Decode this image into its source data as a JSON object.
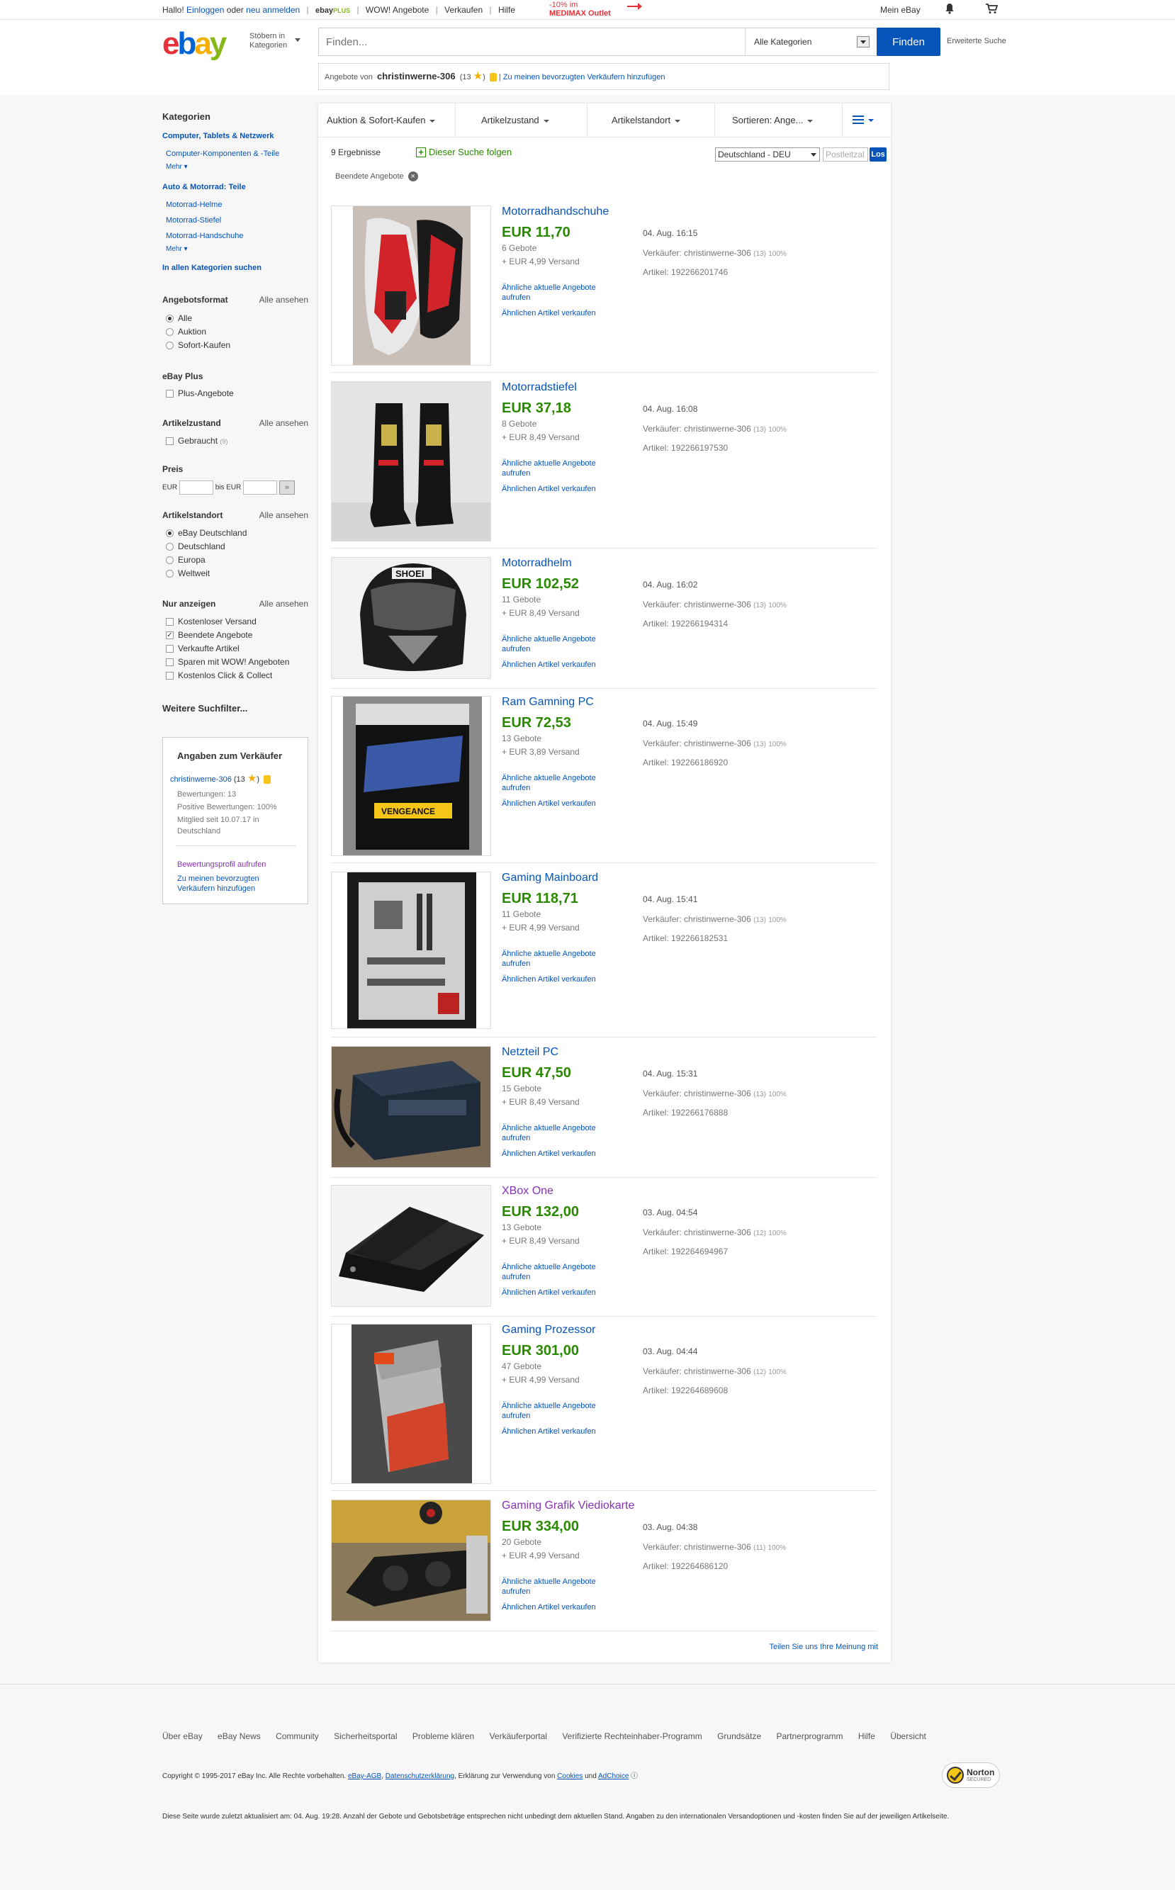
{
  "topbar": {
    "greeting": "Hallo!",
    "login": "Einloggen",
    "or": "oder",
    "register": "neu anmelden",
    "ebay_plus": "ebay",
    "plus": "PLUS",
    "wow": "WOW! Angebote",
    "sell": "Verkaufen",
    "help": "Hilfe",
    "promo_line1": "-10% im",
    "promo_line2": "MEDIMAX Outlet",
    "my_ebay": "Mein eBay"
  },
  "header": {
    "logo": [
      "e",
      "b",
      "a",
      "y"
    ],
    "browse_line1": "Stöbern in",
    "browse_line2": "Kategorien",
    "search_placeholder": "Finden...",
    "category": "Alle Kategorien",
    "find_button": "Finden",
    "advanced": "Erweiterte Suche",
    "offers_from": "Angebote von",
    "seller_name": "christinwerne-306",
    "seller_score_open": "(13",
    "seller_score_close": ")",
    "add_fav": "Zu meinen bevorzugten Verkäufern hinzufügen"
  },
  "sidebar": {
    "categories_title": "Kategorien",
    "cat1": "Computer, Tablets & Netzwerk",
    "cat1_sub1": "Computer-Komponenten & -Teile",
    "more1": "Mehr",
    "cat2": "Auto & Motorrad: Teile",
    "cat2_sub1": "Motorrad-Helme",
    "cat2_sub2": "Motorrad-Stiefel",
    "cat2_sub3": "Motorrad-Handschuhe",
    "more2": "Mehr",
    "all_cats": "In allen Kategorien suchen",
    "format_title": "Angebotsformat",
    "see_all": "Alle ansehen",
    "format_opts": [
      "Alle",
      "Auktion",
      "Sofort-Kaufen"
    ],
    "plus_title": "eBay Plus",
    "plus_opt": "Plus-Angebote",
    "cond_title": "Artikelzustand",
    "cond_opt": "Gebraucht",
    "cond_count": "(9)",
    "price_title": "Preis",
    "eur1": "EUR",
    "to": "bis EUR",
    "go": "»",
    "loc_title": "Artikelstandort",
    "loc_opts": [
      "eBay Deutschland",
      "Deutschland",
      "Europa",
      "Weltweit"
    ],
    "show_title": "Nur anzeigen",
    "show_opts": [
      "Kostenloser Versand",
      "Beendete Angebote",
      "Verkaufte Artikel",
      "Sparen mit WOW! Angeboten",
      "Kostenlos Click & Collect"
    ],
    "more_filters": "Weitere Suchfilter...",
    "seller_card": {
      "title": "Angaben zum Verkäufer",
      "name": "christinwerne-306",
      "score": "(13",
      "score_close": ")",
      "ratings": "Bewertungen: 13",
      "positive": "Positive Bewertungen: 100%",
      "member_since_1": "Mitglied seit 10.07.17 in",
      "member_since_2": "Deutschland",
      "profile_link": "Bewertungsprofil aufrufen",
      "fav_link_1": "Zu meinen bevorzugten",
      "fav_link_2": "Verkäufern hinzufügen"
    }
  },
  "filters": {
    "f1": "Auktion & Sofort-Kaufen",
    "f2": "Artikelzustand",
    "f3": "Artikelstandort",
    "f4": "Sortieren: Ange..."
  },
  "results": {
    "count": "9 Ergebnisse",
    "follow": "Dieser Suche folgen",
    "country": "Deutschland - DEU",
    "postal_placeholder": "Postleitzal",
    "go": "Los",
    "ended_chip": "Beendete Angebote",
    "chip_x": "×",
    "feedback": "Teilen Sie uns Ihre Meinung mit"
  },
  "item_labels": {
    "similar_1": "Ähnliche aktuelle Angebote",
    "similar_2": "aufrufen",
    "sell_similar": "Ähnlichen Artikel verkaufen",
    "seller_prefix": "Verkäufer:",
    "seller_name": "christinwerne-306",
    "feedback_pct": "100%",
    "article_prefix": "Artikel:"
  },
  "items": [
    {
      "title": "Motorradhandschuhe",
      "price": "EUR 11,70",
      "bids": "6 Gebote",
      "shipping": "+ EUR 4,99 Versand",
      "date": "04. Aug. 16:15",
      "score": "(13)",
      "article": "192266201746"
    },
    {
      "title": "Motorradstiefel",
      "price": "EUR 37,18",
      "bids": "8 Gebote",
      "shipping": "+ EUR 8,49 Versand",
      "date": "04. Aug. 16:08",
      "score": "(13)",
      "article": "192266197530"
    },
    {
      "title": "Motorradhelm",
      "price": "EUR 102,52",
      "bids": "11 Gebote",
      "shipping": "+ EUR 8,49 Versand",
      "date": "04. Aug. 16:02",
      "score": "(13)",
      "article": "192266194314"
    },
    {
      "title": "Ram Gamning PC",
      "price": "EUR 72,53",
      "bids": "13 Gebote",
      "shipping": "+ EUR 3,89 Versand",
      "date": "04. Aug. 15:49",
      "score": "(13)",
      "article": "192266186920"
    },
    {
      "title": "Gaming Mainboard",
      "price": "EUR 118,71",
      "bids": "11 Gebote",
      "shipping": "+ EUR 4,99 Versand",
      "date": "04. Aug. 15:41",
      "score": "(13)",
      "article": "192266182531"
    },
    {
      "title": "Netzteil PC",
      "price": "EUR 47,50",
      "bids": "15 Gebote",
      "shipping": "+ EUR 8,49 Versand",
      "date": "04. Aug. 15:31",
      "score": "(13)",
      "article": "192266176888"
    },
    {
      "title": "XBox One",
      "price": "EUR 132,00",
      "bids": "13 Gebote",
      "shipping": "+ EUR 8,49 Versand",
      "date": "03. Aug. 04:54",
      "score": "(12)",
      "article": "192264694967"
    },
    {
      "title": "Gaming Prozessor",
      "price": "EUR 301,00",
      "bids": "47 Gebote",
      "shipping": "+ EUR 4,99 Versand",
      "date": "03. Aug. 04:44",
      "score": "(12)",
      "article": "192264689608"
    },
    {
      "title": "Gaming Grafik Viediokarte",
      "price": "EUR 334,00",
      "bids": "20 Gebote",
      "shipping": "+ EUR 4,99 Versand",
      "date": "03. Aug. 04:38",
      "score": "(11)",
      "article": "192264686120"
    }
  ],
  "footer": {
    "links": [
      "Über eBay",
      "eBay News",
      "Community",
      "Sicherheitsportal",
      "Probleme klären",
      "Verkäuferportal",
      "Verifizierte Rechteinhaber-Programm",
      "Grundsätze",
      "Partnerprogramm",
      "Hilfe",
      "Übersicht"
    ],
    "copyright": "Copyright © 1995-2017 eBay Inc. Alle Rechte vorbehalten.",
    "agb": "eBay-AGB",
    "privacy": "Datenschutzerklärung",
    "cookies_text": ", Erklärung zur Verwendung von",
    "cookies": "Cookies",
    "and": "und",
    "adchoice": "AdChoice",
    "norton": "Norton",
    "secured": "SECURED",
    "disclaimer": "Diese Seite wurde zuletzt aktualisiert am: 04. Aug. 19:28. Anzahl der Gebote und Gebotsbeträge entsprechen nicht unbedingt dem aktuellen Stand. Angaben zu den internationalen Versandoptionen und -kosten finden Sie auf der jeweiligen Artikelseite."
  }
}
